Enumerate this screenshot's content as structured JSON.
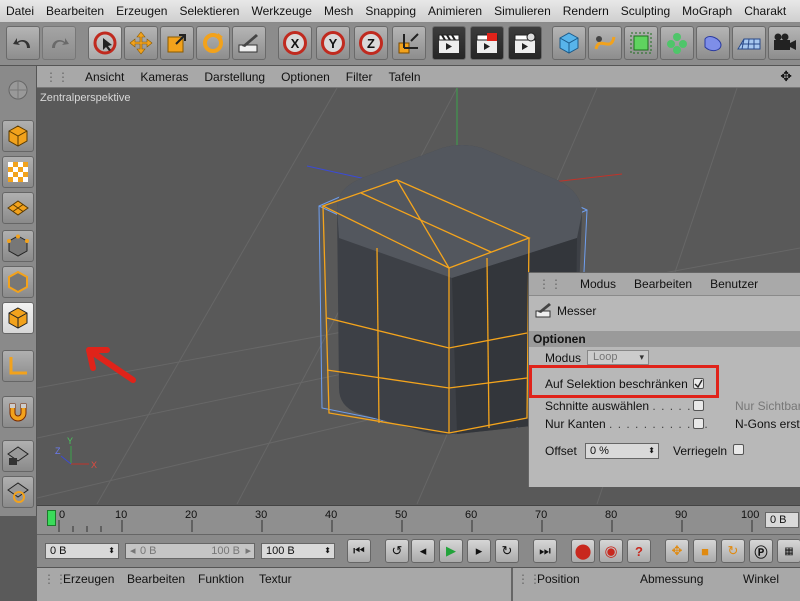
{
  "menubar": [
    "Datei",
    "Bearbeiten",
    "Erzeugen",
    "Selektieren",
    "Werkzeuge",
    "Mesh",
    "Snapping",
    "Animieren",
    "Simulieren",
    "Rendern",
    "Sculpting",
    "MoGraph",
    "Charakt"
  ],
  "viewport_menu": [
    "Ansicht",
    "Kameras",
    "Darstellung",
    "Optionen",
    "Filter",
    "Tafeln"
  ],
  "viewport_label": "Zentralperspektive",
  "axis_labels": {
    "x": "X",
    "y": "Y",
    "z": "Z"
  },
  "toolbar_letters": {
    "x": "X",
    "y": "Y",
    "z": "Z"
  },
  "panel": {
    "menu": [
      "Modus",
      "Bearbeiten",
      "Benutzer"
    ],
    "tool_name": "Messer",
    "section": "Optionen",
    "modus_label": "Modus",
    "modus_value": "Loop",
    "restrict_label": "Auf Selektion beschränken",
    "cuts_label": "Schnitte auswählen",
    "edges_label": "Nur Kanten",
    "visible_label": "Nur Sichtbar",
    "ngons_label": "N-Gons erst",
    "offset_label": "Offset",
    "offset_value": "0 %",
    "lock_label": "Verriegeln"
  },
  "timeline": {
    "ticks": [
      "0",
      "10",
      "20",
      "30",
      "40",
      "50",
      "60",
      "70",
      "80",
      "90",
      "100"
    ],
    "end_field": "0 B"
  },
  "controls": {
    "start": "0 B",
    "range_start": "0 B",
    "range_end": "100 B",
    "end": "100 B"
  },
  "bottom": {
    "left_menu": [
      "Erzeugen",
      "Bearbeiten",
      "Funktion",
      "Textur"
    ],
    "right_menu": [
      "Position",
      "Abmessung",
      "Winkel"
    ]
  },
  "colors": {
    "accent_red": "#e0231a",
    "selection_orange": "#f4a41c",
    "cage_blue": "#6f9ff0"
  }
}
